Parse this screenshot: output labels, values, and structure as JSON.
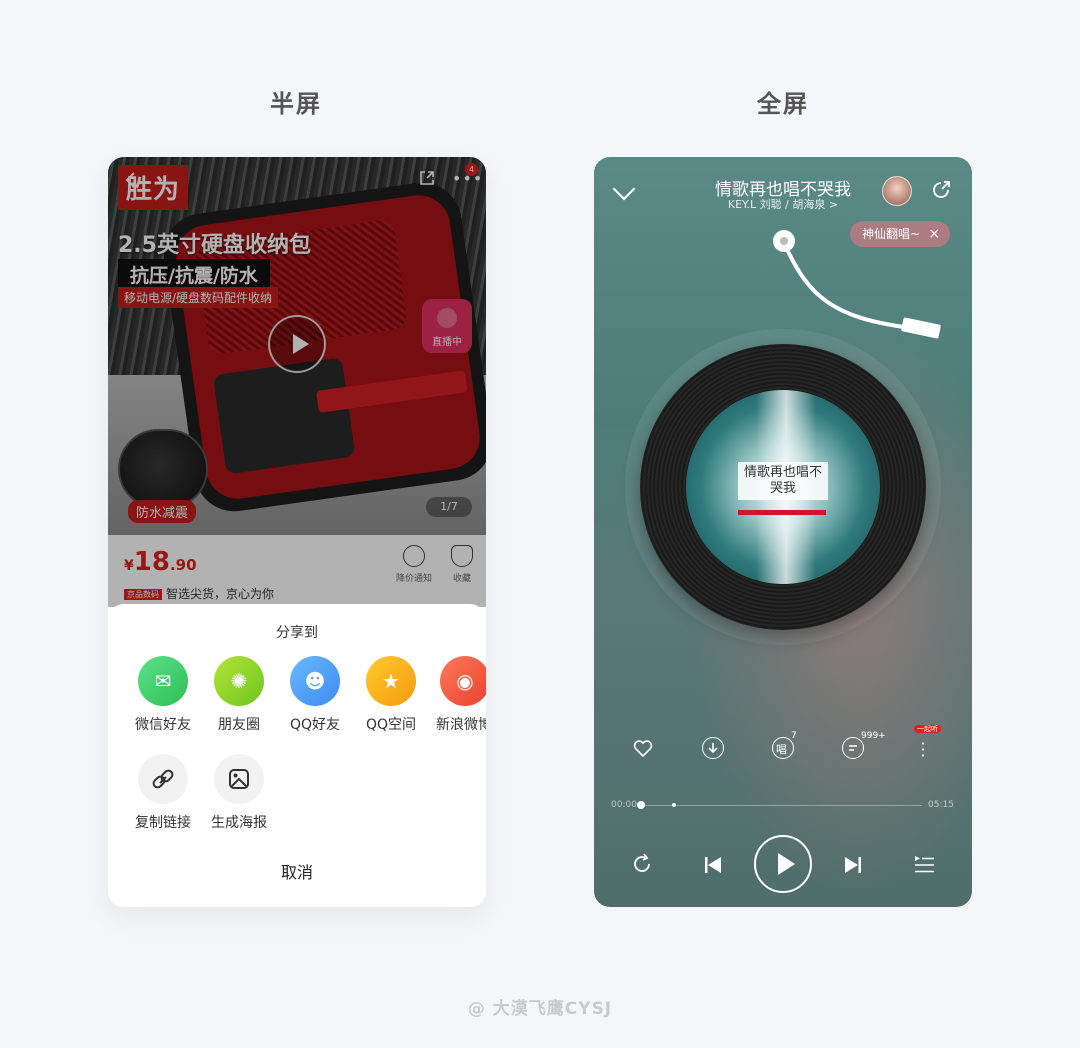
{
  "sections": {
    "left_title": "半屏",
    "right_title": "全屏"
  },
  "product_page": {
    "brand": "胜为",
    "title": "2.5英寸硬盘收纳包",
    "subtitle": "抗压/抗震/防水",
    "tagline": "移动电源/硬盘数码配件收纳",
    "feature_tag": "防水减震",
    "cart_badge": "4",
    "live_label": "直播中",
    "image_counter": "1/7",
    "price": {
      "currency": "¥",
      "integer": "18",
      "decimal": ".90"
    },
    "actions": {
      "notice": "降价通知",
      "favorite": "收藏"
    },
    "promo_badge": "京品数码",
    "promo_text": "智选尖货，京心为你"
  },
  "share_sheet": {
    "title": "分享到",
    "items": [
      {
        "label": "微信好友",
        "icon": "wechat-icon",
        "color": "#3fcf6a"
      },
      {
        "label": "朋友圈",
        "icon": "moments-icon",
        "color": "#8fd32a"
      },
      {
        "label": "QQ好友",
        "icon": "qq-icon",
        "color": "#4aa8f5"
      },
      {
        "label": "QQ空间",
        "icon": "qzone-icon",
        "color": "#f6b318"
      },
      {
        "label": "新浪微博",
        "icon": "weibo-icon",
        "color": "#f0563b"
      },
      {
        "label": "复制链接",
        "icon": "link-icon",
        "color": "#f2f2f2"
      },
      {
        "label": "生成海报",
        "icon": "poster-icon",
        "color": "#f2f2f2"
      }
    ],
    "cancel": "取消"
  },
  "player": {
    "song_title": "情歌再也唱不哭我",
    "artist": "KEY.L 刘聪 / 胡海泉 >",
    "sing_pill": "神仙翻唱~",
    "cover_text": "情歌再也唱不哭我",
    "sing_count": "7",
    "comment_count": "999+",
    "more_tag": "一起听",
    "time_current": "00:00",
    "time_total": "05:15"
  },
  "watermark": "@ 大漠飞鹰CYSJ"
}
